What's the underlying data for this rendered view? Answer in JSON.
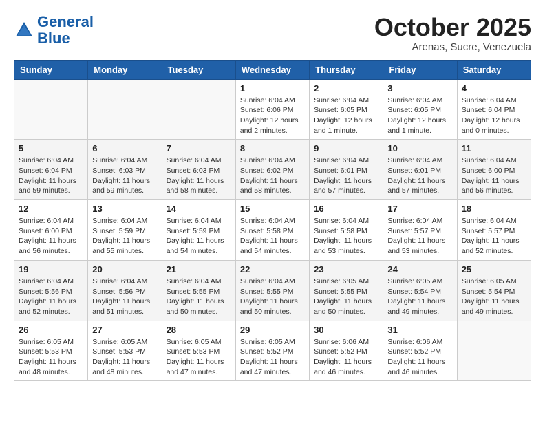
{
  "header": {
    "logo_line1": "General",
    "logo_line2": "Blue",
    "month": "October 2025",
    "location": "Arenas, Sucre, Venezuela"
  },
  "weekdays": [
    "Sunday",
    "Monday",
    "Tuesday",
    "Wednesday",
    "Thursday",
    "Friday",
    "Saturday"
  ],
  "weeks": [
    [
      {
        "day": "",
        "info": ""
      },
      {
        "day": "",
        "info": ""
      },
      {
        "day": "",
        "info": ""
      },
      {
        "day": "1",
        "info": "Sunrise: 6:04 AM\nSunset: 6:06 PM\nDaylight: 12 hours\nand 2 minutes."
      },
      {
        "day": "2",
        "info": "Sunrise: 6:04 AM\nSunset: 6:05 PM\nDaylight: 12 hours\nand 1 minute."
      },
      {
        "day": "3",
        "info": "Sunrise: 6:04 AM\nSunset: 6:05 PM\nDaylight: 12 hours\nand 1 minute."
      },
      {
        "day": "4",
        "info": "Sunrise: 6:04 AM\nSunset: 6:04 PM\nDaylight: 12 hours\nand 0 minutes."
      }
    ],
    [
      {
        "day": "5",
        "info": "Sunrise: 6:04 AM\nSunset: 6:04 PM\nDaylight: 11 hours\nand 59 minutes."
      },
      {
        "day": "6",
        "info": "Sunrise: 6:04 AM\nSunset: 6:03 PM\nDaylight: 11 hours\nand 59 minutes."
      },
      {
        "day": "7",
        "info": "Sunrise: 6:04 AM\nSunset: 6:03 PM\nDaylight: 11 hours\nand 58 minutes."
      },
      {
        "day": "8",
        "info": "Sunrise: 6:04 AM\nSunset: 6:02 PM\nDaylight: 11 hours\nand 58 minutes."
      },
      {
        "day": "9",
        "info": "Sunrise: 6:04 AM\nSunset: 6:01 PM\nDaylight: 11 hours\nand 57 minutes."
      },
      {
        "day": "10",
        "info": "Sunrise: 6:04 AM\nSunset: 6:01 PM\nDaylight: 11 hours\nand 57 minutes."
      },
      {
        "day": "11",
        "info": "Sunrise: 6:04 AM\nSunset: 6:00 PM\nDaylight: 11 hours\nand 56 minutes."
      }
    ],
    [
      {
        "day": "12",
        "info": "Sunrise: 6:04 AM\nSunset: 6:00 PM\nDaylight: 11 hours\nand 56 minutes."
      },
      {
        "day": "13",
        "info": "Sunrise: 6:04 AM\nSunset: 5:59 PM\nDaylight: 11 hours\nand 55 minutes."
      },
      {
        "day": "14",
        "info": "Sunrise: 6:04 AM\nSunset: 5:59 PM\nDaylight: 11 hours\nand 54 minutes."
      },
      {
        "day": "15",
        "info": "Sunrise: 6:04 AM\nSunset: 5:58 PM\nDaylight: 11 hours\nand 54 minutes."
      },
      {
        "day": "16",
        "info": "Sunrise: 6:04 AM\nSunset: 5:58 PM\nDaylight: 11 hours\nand 53 minutes."
      },
      {
        "day": "17",
        "info": "Sunrise: 6:04 AM\nSunset: 5:57 PM\nDaylight: 11 hours\nand 53 minutes."
      },
      {
        "day": "18",
        "info": "Sunrise: 6:04 AM\nSunset: 5:57 PM\nDaylight: 11 hours\nand 52 minutes."
      }
    ],
    [
      {
        "day": "19",
        "info": "Sunrise: 6:04 AM\nSunset: 5:56 PM\nDaylight: 11 hours\nand 52 minutes."
      },
      {
        "day": "20",
        "info": "Sunrise: 6:04 AM\nSunset: 5:56 PM\nDaylight: 11 hours\nand 51 minutes."
      },
      {
        "day": "21",
        "info": "Sunrise: 6:04 AM\nSunset: 5:55 PM\nDaylight: 11 hours\nand 50 minutes."
      },
      {
        "day": "22",
        "info": "Sunrise: 6:04 AM\nSunset: 5:55 PM\nDaylight: 11 hours\nand 50 minutes."
      },
      {
        "day": "23",
        "info": "Sunrise: 6:05 AM\nSunset: 5:55 PM\nDaylight: 11 hours\nand 50 minutes."
      },
      {
        "day": "24",
        "info": "Sunrise: 6:05 AM\nSunset: 5:54 PM\nDaylight: 11 hours\nand 49 minutes."
      },
      {
        "day": "25",
        "info": "Sunrise: 6:05 AM\nSunset: 5:54 PM\nDaylight: 11 hours\nand 49 minutes."
      }
    ],
    [
      {
        "day": "26",
        "info": "Sunrise: 6:05 AM\nSunset: 5:53 PM\nDaylight: 11 hours\nand 48 minutes."
      },
      {
        "day": "27",
        "info": "Sunrise: 6:05 AM\nSunset: 5:53 PM\nDaylight: 11 hours\nand 48 minutes."
      },
      {
        "day": "28",
        "info": "Sunrise: 6:05 AM\nSunset: 5:53 PM\nDaylight: 11 hours\nand 47 minutes."
      },
      {
        "day": "29",
        "info": "Sunrise: 6:05 AM\nSunset: 5:52 PM\nDaylight: 11 hours\nand 47 minutes."
      },
      {
        "day": "30",
        "info": "Sunrise: 6:06 AM\nSunset: 5:52 PM\nDaylight: 11 hours\nand 46 minutes."
      },
      {
        "day": "31",
        "info": "Sunrise: 6:06 AM\nSunset: 5:52 PM\nDaylight: 11 hours\nand 46 minutes."
      },
      {
        "day": "",
        "info": ""
      }
    ]
  ]
}
